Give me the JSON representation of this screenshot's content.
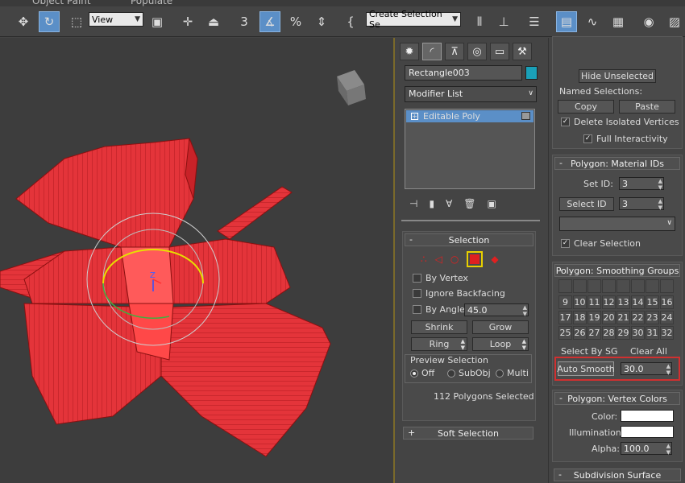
{
  "menu": {
    "items": [
      "Object Paint",
      "Populate"
    ]
  },
  "toolbar": {
    "view_select": "View",
    "named_selection": "Create Selection Se",
    "snap_label": "3",
    "percent_label": "%"
  },
  "viewport": {
    "gizmo_axis": "Z"
  },
  "command_panel": {
    "object_name": "Rectangle003",
    "object_color": "#1aa0b8",
    "modifier_list": "Modifier List",
    "stack_item": "Editable Poly",
    "selection": {
      "title": "Selection",
      "by_vertex": "By Vertex",
      "ignore_backfacing": "Ignore Backfacing",
      "by_angle": "By Angle:",
      "angle_value": "45.0",
      "shrink": "Shrink",
      "grow": "Grow",
      "ring": "Ring",
      "loop": "Loop",
      "preview_title": "Preview Selection",
      "off": "Off",
      "subobj": "SubObj",
      "multi": "Multi",
      "status": "112 Polygons Selected"
    },
    "soft_selection": "Soft Selection"
  },
  "right_panel": {
    "hide_unselected": "Hide Unselected",
    "named_selections": "Named Selections:",
    "copy": "Copy",
    "paste": "Paste",
    "delete_isolated": "Delete Isolated Vertices",
    "full_interactivity": "Full Interactivity",
    "material_ids": {
      "title": "Polygon: Material IDs",
      "set_id_label": "Set ID:",
      "set_id_value": "3",
      "select_id": "Select ID",
      "select_id_value": "3",
      "clear_selection": "Clear Selection"
    },
    "smoothing_groups": {
      "title": "Polygon: Smoothing Groups",
      "row1": [
        "9",
        "10",
        "11",
        "12",
        "13",
        "14",
        "15",
        "16"
      ],
      "row2": [
        "17",
        "18",
        "19",
        "20",
        "21",
        "22",
        "23",
        "24"
      ],
      "row3": [
        "25",
        "26",
        "27",
        "28",
        "29",
        "30",
        "31",
        "32"
      ],
      "select_by_sg": "Select By SG",
      "clear_all": "Clear All",
      "auto_smooth": "Auto Smooth",
      "auto_smooth_value": "30.0"
    },
    "vertex_colors": {
      "title": "Polygon: Vertex Colors",
      "color_label": "Color:",
      "illumination_label": "Illumination:",
      "alpha_label": "Alpha:",
      "alpha_value": "100.0"
    },
    "subdivision": "Subdivision Surface"
  },
  "colors": {
    "selection_red": "#e02020",
    "highlight": "#d03030"
  }
}
